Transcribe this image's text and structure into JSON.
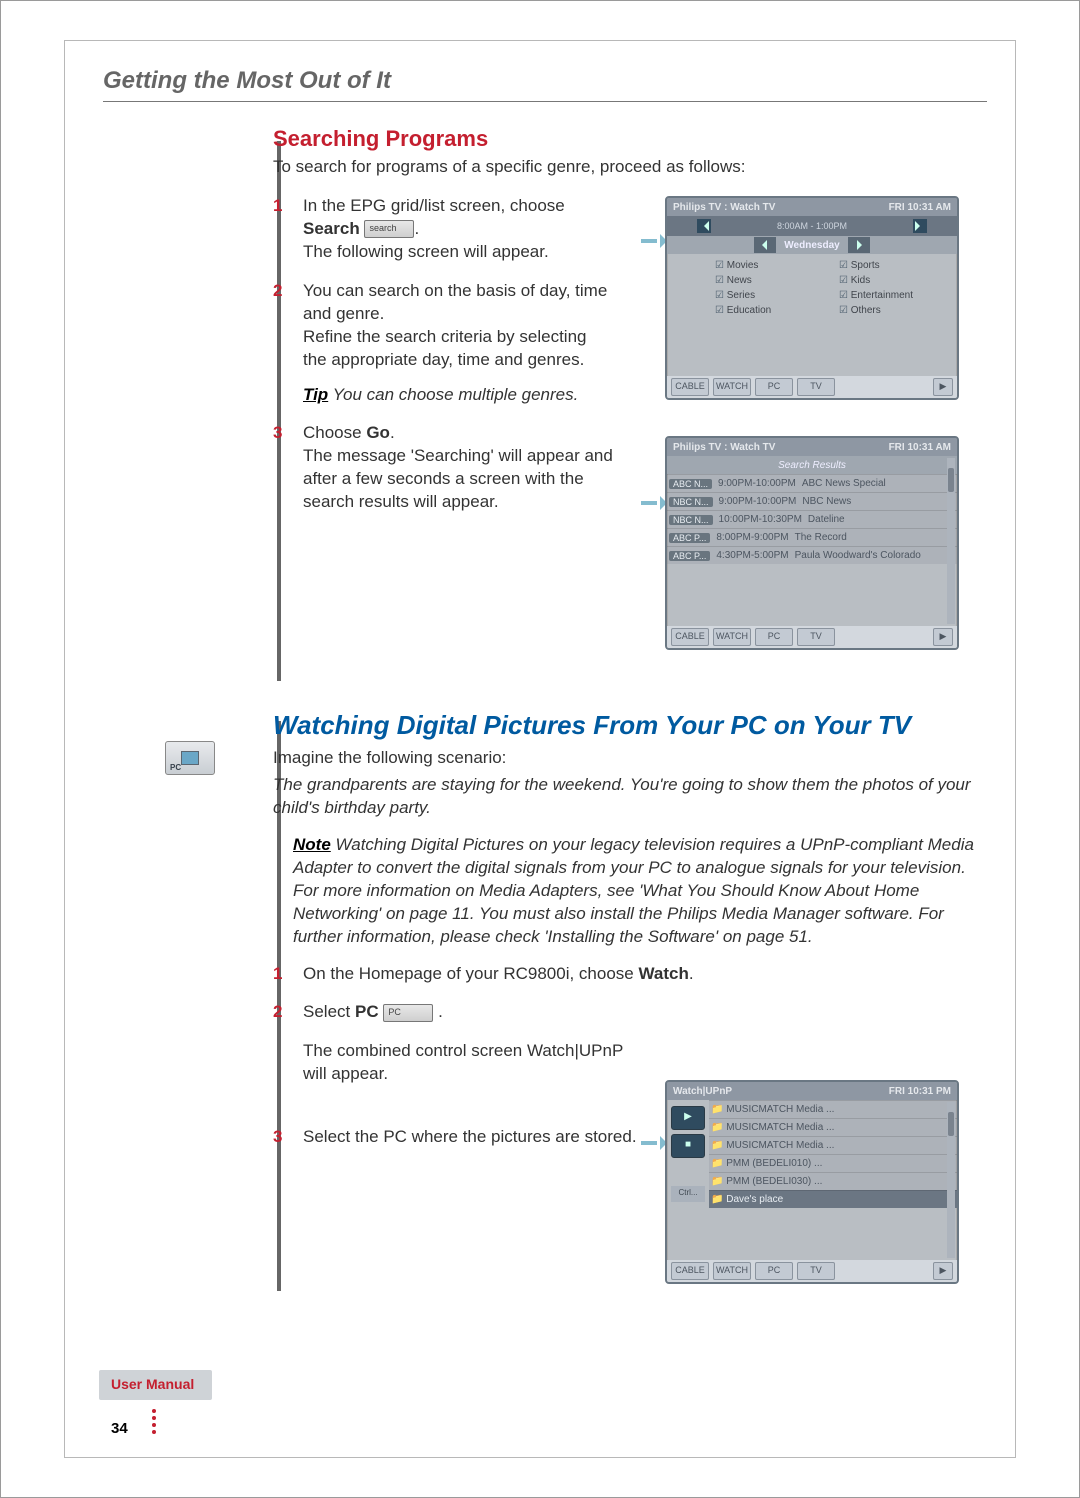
{
  "header": {
    "title": "Getting the Most Out of It"
  },
  "section1": {
    "heading": "Searching Programs",
    "lead": "To search for programs of a specific genre, proceed as follows:",
    "steps": [
      {
        "num": "1",
        "line1a": "In the EPG grid/list screen, choose",
        "bold": "Search",
        "btn": "search",
        "after": ".",
        "line2": "The following screen will appear."
      },
      {
        "num": "2",
        "line1": "You can search on the basis of day, time and genre.",
        "line2": "Refine the search criteria by selecting the appropriate day, time and genres.",
        "tip_label": "Tip",
        "tip": "You can choose multiple genres."
      },
      {
        "num": "3",
        "line1a": "Choose ",
        "bold": "Go",
        "after": ".",
        "line2": "The message 'Searching' will appear and after a few seconds a screen with the search results will appear."
      }
    ]
  },
  "shot1": {
    "title": "Philips TV : Watch TV",
    "clock": "FRI 10:31 AM",
    "time_range": "8:00AM - 1:00PM",
    "day": "Wednesday",
    "genres": [
      "Movies",
      "Sports",
      "News",
      "Kids",
      "Series",
      "Entertainment",
      "Education",
      "Others"
    ],
    "footer": [
      "CABLE",
      "WATCH",
      "PC",
      "TV"
    ]
  },
  "shot2": {
    "title": "Philips TV : Watch TV",
    "clock": "FRI 10:31 AM",
    "heading": "Search Results",
    "rows": [
      {
        "ch": "ABC N...",
        "time": "9:00PM-10:00PM",
        "prog": "ABC News Special"
      },
      {
        "ch": "NBC N...",
        "time": "9:00PM-10:00PM",
        "prog": "NBC News"
      },
      {
        "ch": "NBC N...",
        "time": "10:00PM-10:30PM",
        "prog": "Dateline"
      },
      {
        "ch": "ABC P...",
        "time": "8:00PM-9:00PM",
        "prog": "The Record"
      },
      {
        "ch": "ABC P...",
        "time": "4:30PM-5:00PM",
        "prog": "Paula Woodward's Colorado"
      }
    ],
    "footer": [
      "CABLE",
      "WATCH",
      "PC",
      "TV"
    ]
  },
  "section2": {
    "heading": "Watching Digital Pictures From Your PC on Your TV",
    "intro": "Imagine the following scenario:",
    "scenario": "The grandparents are staying for the weekend. You're going to show them the photos of your child's birthday party.",
    "note_label": "Note",
    "note": "Watching Digital Pictures on your legacy television requires a UPnP-compliant Media Adapter to convert the digital signals from your PC to analogue signals for your television. For more information on Media Adapters, see 'What You Should Know About Home Networking' on page 11.\nYou must also install the Philips Media Manager software. For further information, please check 'Installing the Software' on page 51.",
    "steps": [
      {
        "num": "1",
        "line1a": "On the Homepage of your RC9800i, choose ",
        "bold": "Watch",
        "after": "."
      },
      {
        "num": "2",
        "line1a": "Select ",
        "bold": "PC",
        "btn": "PC",
        "after": " .",
        "line2a": "The combined control screen Watch|UPnP will appear."
      },
      {
        "num": "3",
        "line1": "Select the PC where the pictures are stored."
      }
    ]
  },
  "shot3": {
    "title": "Watch|UPnP",
    "clock": "FRI 10:31 PM",
    "rows": [
      "MUSICMATCH Media ...",
      "MUSICMATCH Media ...",
      "MUSICMATCH Media ...",
      "PMM (BEDELI010) ...",
      "PMM (BEDELI030) ...",
      "Dave's place"
    ],
    "left_btns": [
      "▶",
      "■"
    ],
    "ctrl": "Ctrl...",
    "footer": [
      "CABLE",
      "WATCH",
      "PC",
      "TV"
    ]
  },
  "footer": {
    "label": "User Manual",
    "page": "34"
  }
}
